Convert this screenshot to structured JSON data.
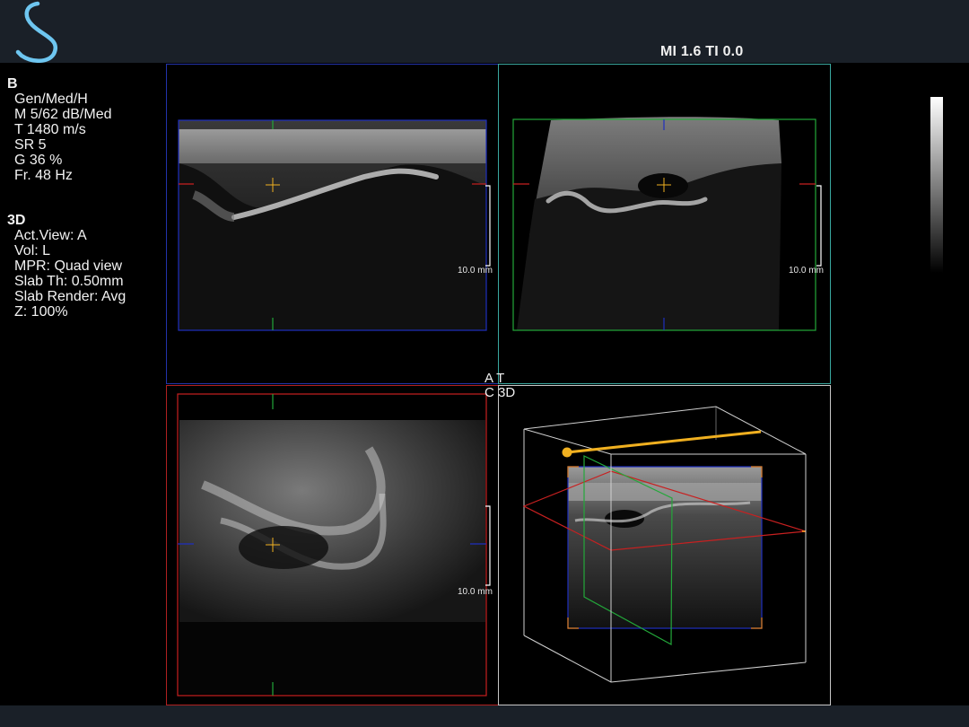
{
  "header": {
    "mi_ti": "MI 1.6  TI 0.0",
    "logo_icon": "s-logo-icon"
  },
  "b_mode": {
    "title": "B",
    "lines": [
      "Gen/Med/H",
      "M 5/62 dB/Med",
      "T 1480 m/s",
      "SR 5",
      "G 36 %",
      "Fr. 48 Hz"
    ]
  },
  "three_d": {
    "title": "3D",
    "lines": [
      "Act.View: A",
      "Vol: L",
      "MPR: Quad view",
      "Slab Th: 0.50mm",
      "Slab Render: Avg",
      "Z: 100%"
    ]
  },
  "views": {
    "a": {
      "scale": "10.0 mm"
    },
    "b": {
      "scale": "10.0 mm"
    },
    "c": {
      "scale": "10.0 mm"
    },
    "labels": {
      "at": "A T",
      "c3d": "C 3D"
    }
  },
  "colors": {
    "topbar": "#1a2028",
    "view_a": "#2233aa",
    "view_b": "#3aa8a0",
    "view_c": "#b02020",
    "view_d": "#c8c8c8",
    "plane_a": "#1f2fbf",
    "plane_b": "#23a83a",
    "plane_c": "#c82020",
    "marker": "#f0b020"
  }
}
